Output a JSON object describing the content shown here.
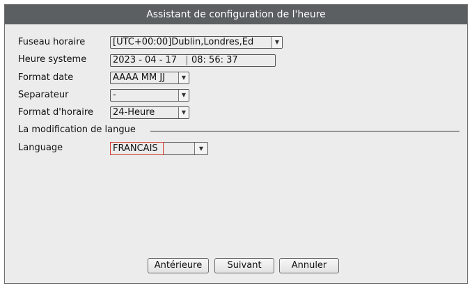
{
  "window": {
    "title": "Assistant de configuration de l'heure"
  },
  "fields": {
    "timezone": {
      "label": "Fuseau horaire",
      "value": "[UTC+00:00]Dublin,Londres,Ed"
    },
    "system_time": {
      "label": "Heure systeme",
      "date": "2023 - 04 - 17",
      "time": "08: 56: 37"
    },
    "date_format": {
      "label": "Format date",
      "value": "AAAA MM JJ"
    },
    "separator": {
      "label": "Separateur",
      "value": "-"
    },
    "time_format": {
      "label": "Format d'horaire",
      "value": "24-Heure"
    }
  },
  "section": {
    "title": "La modification de langue"
  },
  "language": {
    "label": "Language",
    "value": "FRANCAIS"
  },
  "buttons": {
    "previous": "Antérieure",
    "next": "Suivant",
    "cancel": "Annuler"
  },
  "icons": {
    "dropdown": "chevron-down-icon"
  },
  "colors": {
    "titlebar": "#5b5f62",
    "background": "#ececec",
    "highlight": "#d23a2a"
  }
}
